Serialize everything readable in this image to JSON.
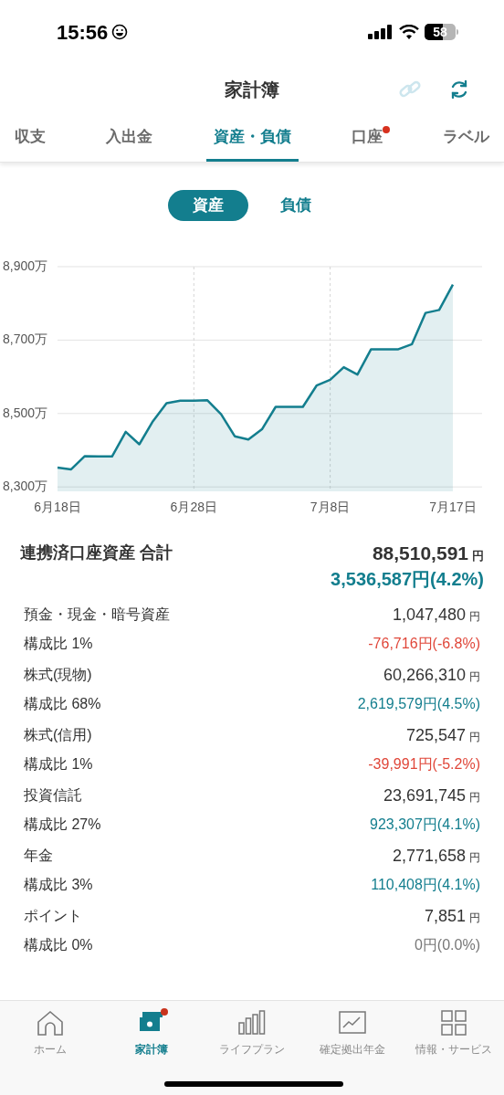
{
  "status_bar": {
    "time": "15:56",
    "battery": "58"
  },
  "header": {
    "title": "家計簿"
  },
  "tabs": [
    {
      "label": "収支",
      "selected": false,
      "badge": false
    },
    {
      "label": "入出金",
      "selected": false,
      "badge": false
    },
    {
      "label": "資産・負債",
      "selected": true,
      "badge": false
    },
    {
      "label": "口座",
      "selected": false,
      "badge": true
    },
    {
      "label": "ラベル",
      "selected": false,
      "badge": false
    }
  ],
  "segments": [
    {
      "label": "資産",
      "selected": true
    },
    {
      "label": "負債",
      "selected": false
    }
  ],
  "chart_data": {
    "type": "area",
    "categories": [
      "6月18日",
      null,
      null,
      null,
      null,
      null,
      null,
      null,
      null,
      null,
      "6月28日",
      null,
      null,
      null,
      null,
      null,
      null,
      null,
      null,
      null,
      "7月8日",
      null,
      null,
      null,
      null,
      null,
      null,
      null,
      null,
      "7月17日"
    ],
    "series": [
      {
        "color": "#137e8e",
        "values": [
          8353,
          8348,
          8384,
          8383,
          8383,
          8450,
          8416,
          8479,
          8528,
          8535,
          8535,
          8536,
          8498,
          8438,
          8429,
          8457,
          8518,
          8518,
          8518,
          8576,
          8592,
          8626,
          8606,
          8675,
          8675,
          8675,
          8689,
          8774,
          8782,
          8851
        ]
      }
    ],
    "ylim": [
      8288,
      8900
    ],
    "grid": true,
    "yticks": [
      {
        "value": 8900,
        "label": "8,900万"
      },
      {
        "value": 8700,
        "label": "8,700万"
      },
      {
        "value": 8500,
        "label": "8,500万"
      },
      {
        "value": 8300,
        "label": "8,300万"
      }
    ]
  },
  "summary": {
    "label": "連携済口座資産 合計",
    "amount": "88,510,591",
    "unit": "円",
    "change": "3,536,587円(4.2%)"
  },
  "assets": [
    {
      "name": "預金・現金・暗号資産",
      "share": "構成比 1%",
      "amount": "1,047,480",
      "unit": "円",
      "change": "-76,716円(-6.8%)",
      "kind": "down"
    },
    {
      "name": "株式(現物)",
      "share": "構成比 68%",
      "amount": "60,266,310",
      "unit": "円",
      "change": "2,619,579円(4.5%)",
      "kind": "up"
    },
    {
      "name": "株式(信用)",
      "share": "構成比 1%",
      "amount": "725,547",
      "unit": "円",
      "change": "-39,991円(-5.2%)",
      "kind": "down"
    },
    {
      "name": "投資信託",
      "share": "構成比 27%",
      "amount": "23,691,745",
      "unit": "円",
      "change": "923,307円(4.1%)",
      "kind": "up"
    },
    {
      "name": "年金",
      "share": "構成比 3%",
      "amount": "2,771,658",
      "unit": "円",
      "change": "110,408円(4.1%)",
      "kind": "up"
    },
    {
      "name": "ポイント",
      "share": "構成比 0%",
      "amount": "7,851",
      "unit": "円",
      "change": "0円(0.0%)",
      "kind": "flat"
    }
  ],
  "bottom_nav": [
    {
      "label": "ホーム",
      "kind": "home",
      "selected": false,
      "badge": false
    },
    {
      "label": "家計簿",
      "kind": "wallet",
      "selected": true,
      "badge": true
    },
    {
      "label": "ライフプラン",
      "kind": "bars",
      "selected": false,
      "badge": false
    },
    {
      "label": "確定拠出年金",
      "kind": "chart",
      "selected": false,
      "badge": false
    },
    {
      "label": "情報・サービス",
      "kind": "grid",
      "selected": false,
      "badge": false
    }
  ]
}
